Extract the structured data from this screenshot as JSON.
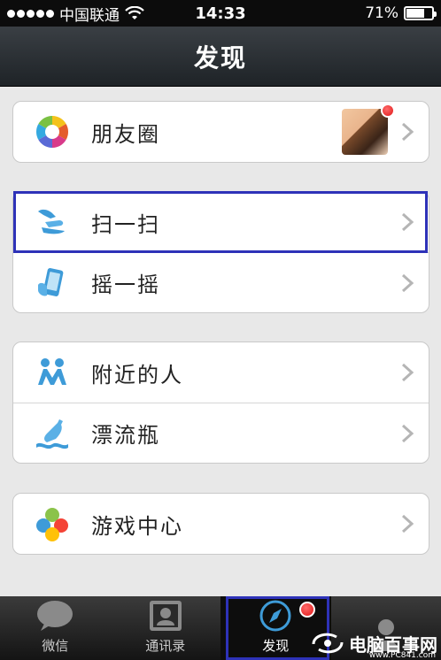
{
  "status_bar": {
    "carrier": "中国联通",
    "time": "14:33",
    "battery": "71%",
    "battery_level": 0.71
  },
  "nav": {
    "title": "发现"
  },
  "groups": [
    {
      "items": [
        {
          "label": "朋友圈",
          "icon": "moments-icon",
          "has_thumbnail": true,
          "has_badge": true
        }
      ]
    },
    {
      "items": [
        {
          "label": "扫一扫",
          "icon": "scan-icon",
          "highlighted": true
        },
        {
          "label": "摇一摇",
          "icon": "shake-icon"
        }
      ]
    },
    {
      "items": [
        {
          "label": "附近的人",
          "icon": "people-nearby-icon"
        },
        {
          "label": "漂流瓶",
          "icon": "drift-bottle-icon"
        }
      ]
    },
    {
      "items": [
        {
          "label": "游戏中心",
          "icon": "game-center-icon"
        }
      ]
    }
  ],
  "tab_bar": {
    "tabs": [
      {
        "label": "微信",
        "icon": "chat-bubble-icon",
        "active": false
      },
      {
        "label": "通讯录",
        "icon": "contacts-icon",
        "active": false
      },
      {
        "label": "发现",
        "icon": "compass-icon",
        "active": true,
        "has_badge": true
      },
      {
        "label": "",
        "icon": "profile-icon",
        "active": false
      }
    ]
  },
  "watermark": {
    "text": "电脑百事网",
    "sub": "www.PC841.com"
  },
  "colors": {
    "highlight": "#2e32b8",
    "badge": "#e01818",
    "nav_bg": "#2a2f33"
  }
}
